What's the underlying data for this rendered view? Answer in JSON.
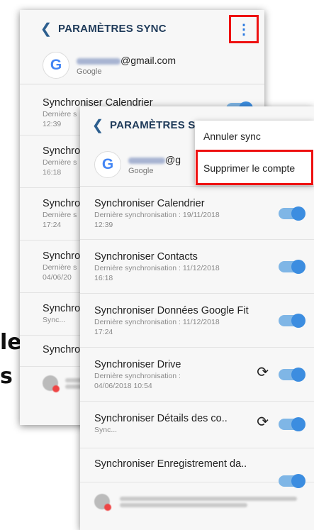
{
  "background_text": {
    "line1": "les",
    "line2": "s"
  },
  "back_phone": {
    "header": {
      "title": "PARAMÈTRES SYNC"
    },
    "account": {
      "email_suffix": "@gmail.com",
      "provider": "Google"
    },
    "rows": [
      {
        "title": "Synchroniser Calendrier",
        "sub1": "Dernière s",
        "sub2": "12:39"
      },
      {
        "title": "Synchro",
        "sub1": "Dernière s",
        "sub2": "16:18"
      },
      {
        "title": "Synchro",
        "sub1": "Dernière s",
        "sub2": "17:24"
      },
      {
        "title": "Synchro",
        "sub1": "Dernière s",
        "sub2": "04/06/20"
      },
      {
        "title": "Synchro",
        "sub1": "Sync..."
      },
      {
        "title": "Synchro"
      }
    ]
  },
  "front_phone": {
    "header": {
      "title": "PARAMÈTRES SY"
    },
    "account": {
      "email_suffix": "@g",
      "provider": "Google"
    },
    "rows": [
      {
        "title": "Synchroniser Calendrier",
        "sub1": "Dernière synchronisation : 19/11/2018",
        "sub2": "12:39",
        "toggle": true
      },
      {
        "title": "Synchroniser Contacts",
        "sub1": "Dernière synchronisation : 11/12/2018",
        "sub2": "16:18",
        "toggle": true
      },
      {
        "title": "Synchroniser Données Google Fit",
        "sub1": "Dernière synchronisation : 11/12/2018",
        "sub2": "17:24",
        "toggle": true
      },
      {
        "title": "Synchroniser Drive",
        "sub1": "Dernière synchronisation :",
        "sub2": "04/06/2018 10:54",
        "toggle": true,
        "syncing_icon": true
      },
      {
        "title": "Synchroniser Détails des co..",
        "sub1": "Sync...",
        "toggle": true,
        "syncing_icon": true
      },
      {
        "title": "Synchroniser Enregistrement da..",
        "toggle": true
      }
    ]
  },
  "menu": {
    "items": [
      {
        "label": "Annuler sync"
      },
      {
        "label": "Supprimer le compte"
      }
    ]
  },
  "colors": {
    "accent": "#3c8de0",
    "highlight": "#ee1111",
    "header_text": "#1f3b5a"
  },
  "icons": [
    "back-chevron-icon",
    "more-vert-icon",
    "google-icon",
    "sync-icon",
    "error-icon"
  ]
}
